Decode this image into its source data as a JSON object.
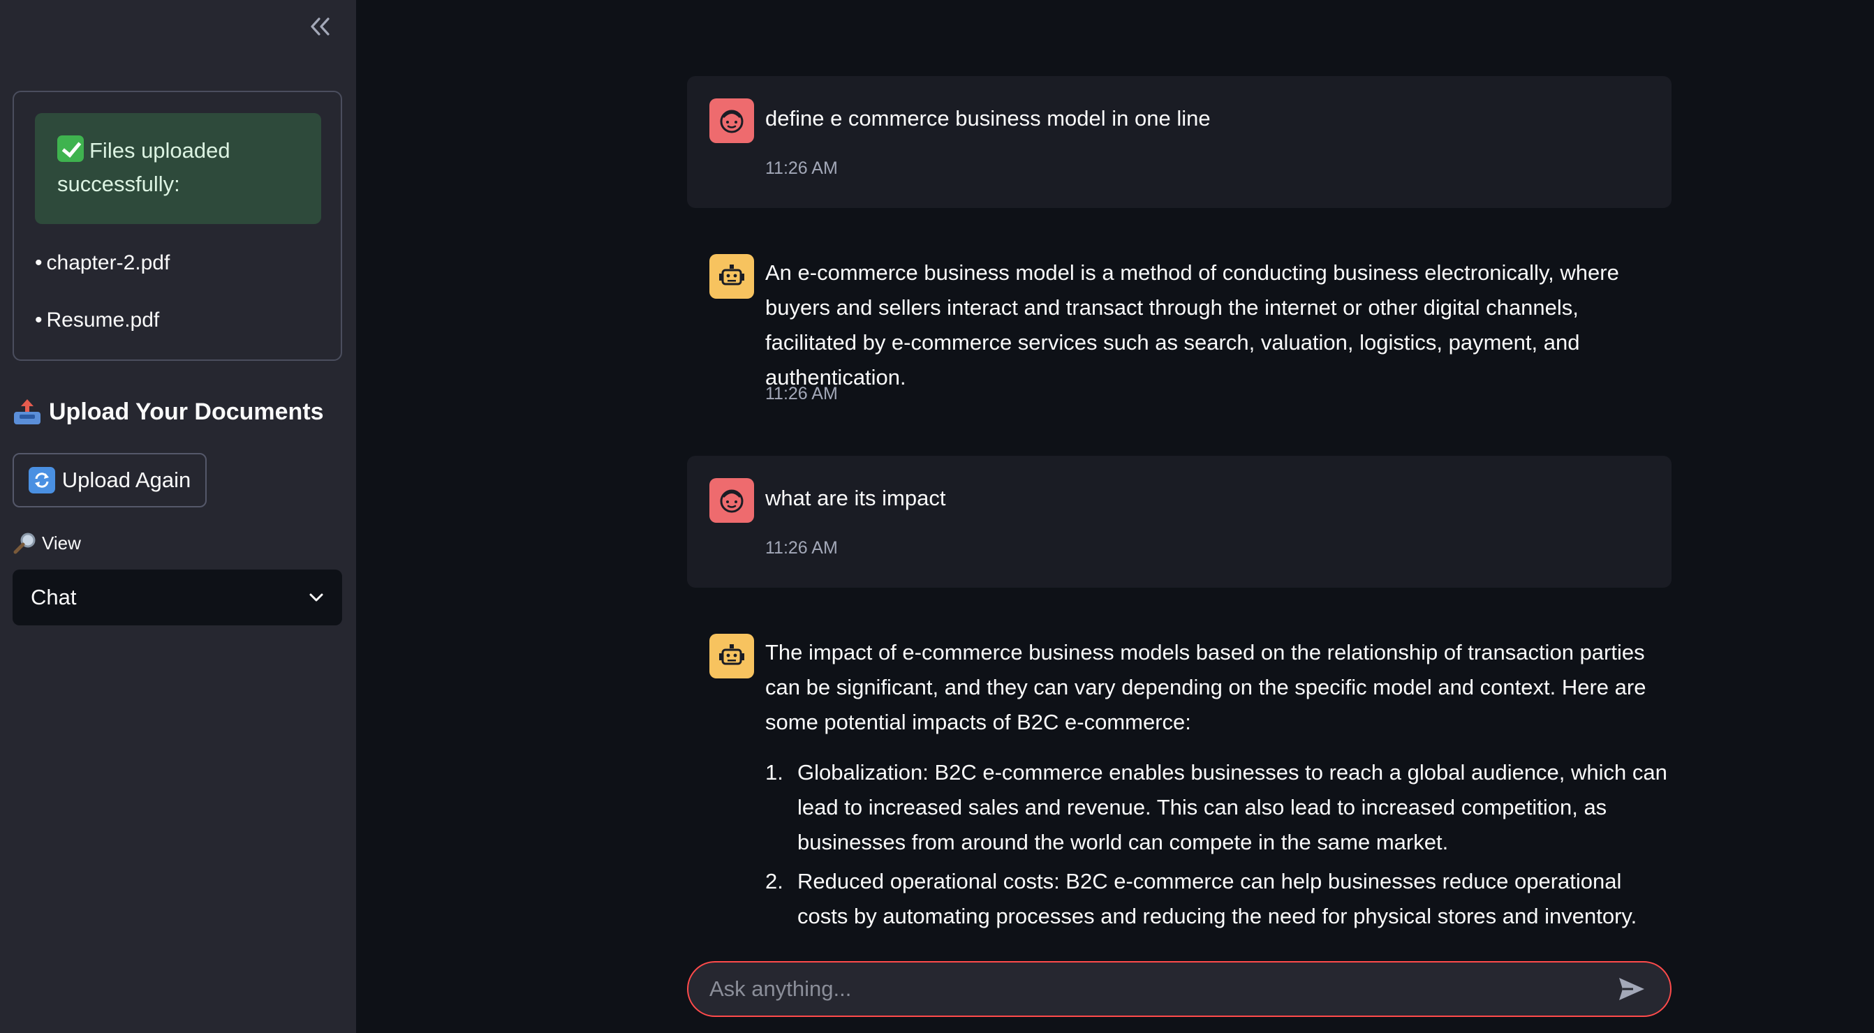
{
  "sidebar": {
    "files_box": {
      "success_text": "Files uploaded successfully:",
      "files": [
        "chapter-2.pdf",
        "Resume.pdf"
      ]
    },
    "upload_heading": "Upload Your Documents",
    "upload_again_label": "Upload Again",
    "view_label": "View",
    "view_select_value": "Chat"
  },
  "chat": {
    "messages": [
      {
        "role": "user",
        "text": "define e commerce business model in one line",
        "time": "11:26 AM"
      },
      {
        "role": "assistant",
        "text": "An e-commerce business model is a method of conducting business electronically, where buyers and sellers interact and transact through the internet or other digital channels, facilitated by e-commerce services such as search, valuation, logistics, payment, and authentication.",
        "time": "11:26 AM"
      },
      {
        "role": "user",
        "text": "what are its impact",
        "time": "11:26 AM"
      },
      {
        "role": "assistant",
        "text": "The impact of e-commerce business models based on the relationship of transaction parties can be significant, and they can vary depending on the specific model and context. Here are some potential impacts of B2C e-commerce:",
        "list": [
          {
            "num": "1.",
            "text": "Globalization: B2C e-commerce enables businesses to reach a global audience, which can lead to increased sales and revenue. This can also lead to increased competition, as businesses from around the world can compete in the same market."
          },
          {
            "num": "2.",
            "text": "Reduced operational costs: B2C e-commerce can help businesses reduce operational costs by automating processes and reducing the need for physical stores and inventory. This can lead"
          }
        ]
      }
    ],
    "input_placeholder": "Ask anything..."
  },
  "colors": {
    "sidebar_bg": "#262730",
    "main_bg": "#0e1117",
    "user_avatar": "#ee6b6e",
    "bot_avatar": "#f7c35f",
    "success_bg": "#2e4a3b",
    "input_border": "#ff4b4b"
  }
}
